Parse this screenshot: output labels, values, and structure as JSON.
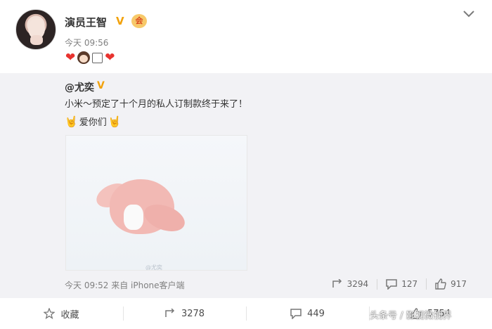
{
  "post": {
    "author": "演员王智",
    "verified_badge": "V",
    "vip_badge": "会员",
    "time": "今天 09:56",
    "emoji_line": [
      "heart",
      "girl-face",
      "box",
      "heart"
    ]
  },
  "repost": {
    "original_author": "@尤奕",
    "original_verified_badge": "V",
    "text_line1": "小米～预定了十个月的私人订制款终于来了！",
    "text_line2": "爱你们",
    "photo_watermark": "@尤奕",
    "meta": "今天 09:52 来自 iPhone客户端",
    "stats": {
      "reposts": "3294",
      "comments": "127",
      "likes": "917"
    }
  },
  "actions": {
    "favorite_label": "收藏",
    "repost_count": "3278",
    "comment_count": "449",
    "like_count": "5754"
  },
  "overlay": {
    "source_watermark": "头条号 / 影视微视界"
  },
  "colors": {
    "accent_verified": "#f2a20c",
    "heart": "#e8332f",
    "repost_background": "#f2f2f5"
  },
  "icons": [
    "chevron-down-icon",
    "repost-icon",
    "comment-icon",
    "like-icon",
    "star-icon"
  ]
}
